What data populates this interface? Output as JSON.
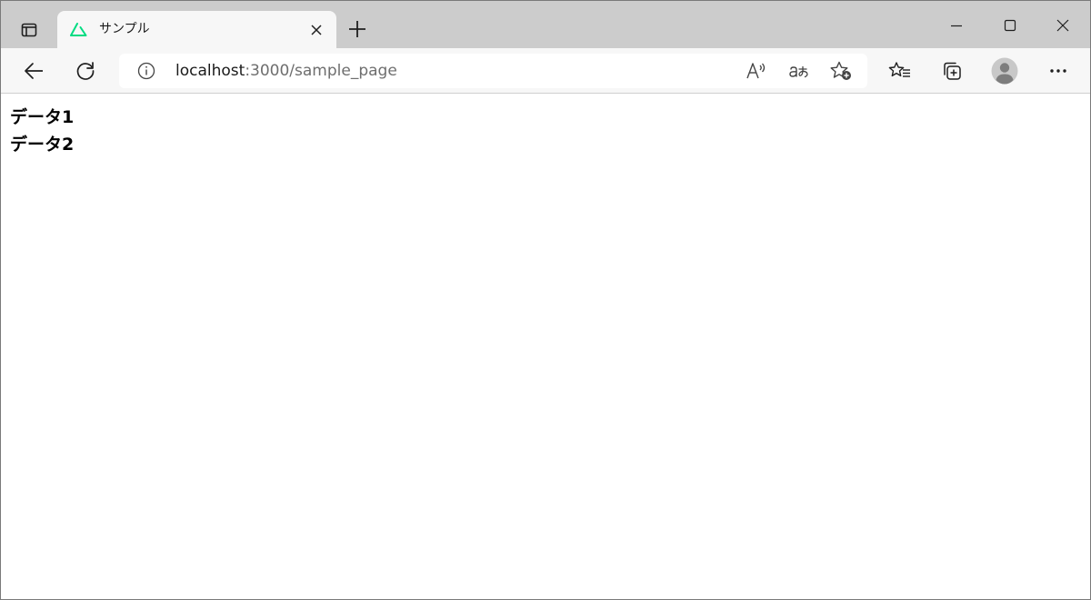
{
  "browser": {
    "tab": {
      "title": "サンプル"
    },
    "address": {
      "host": "localhost",
      "rest": ":3000/sample_page"
    },
    "icons": {
      "tab_actions": "tab-actions-icon",
      "favicon": "nuxt-logo-icon",
      "close_tab": "close-icon",
      "new_tab": "plus-icon",
      "minimize": "minimize-icon",
      "maximize": "maximize-icon",
      "close_window": "close-icon",
      "back": "arrow-left-icon",
      "refresh": "refresh-icon",
      "site_info": "info-icon",
      "read_aloud": "read-aloud-icon",
      "translate": "translate-icon",
      "add_favorite": "star-plus-icon",
      "favorites": "favorites-icon",
      "collections": "collections-icon",
      "profile": "avatar-icon",
      "more": "more-icon"
    },
    "colors": {
      "tabstrip": "#cccccc",
      "toolbar": "#f7f7f7",
      "favicon": "#00dc82"
    }
  },
  "page": {
    "items": [
      "データ1",
      "データ2"
    ]
  }
}
